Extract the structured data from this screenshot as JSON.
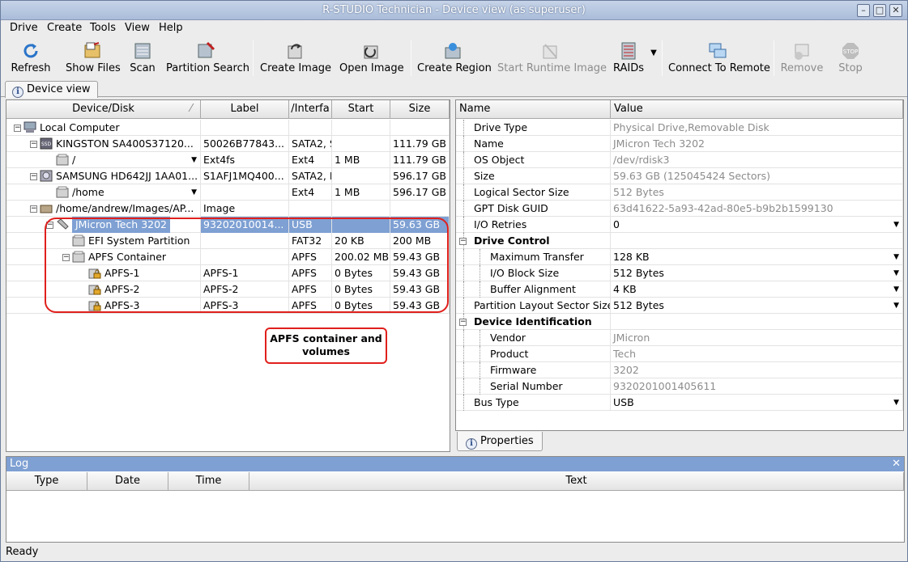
{
  "window": {
    "title": "R-STUDIO Technician - Device view (as superuser)"
  },
  "menu": [
    "Drive",
    "Create",
    "Tools",
    "View",
    "Help"
  ],
  "toolbar": {
    "refresh": "Refresh",
    "show_files": "Show Files",
    "scan": "Scan",
    "partition_search": "Partition Search",
    "create_image": "Create Image",
    "open_image": "Open Image",
    "create_region": "Create Region",
    "start_runtime_image": "Start Runtime Image",
    "raids": "RAIDs",
    "connect_to_remote": "Connect To Remote",
    "remove": "Remove",
    "stop": "Stop"
  },
  "tabs": {
    "device_view": "Device view",
    "properties": "Properties"
  },
  "device_table": {
    "columns": [
      "Device/Disk",
      "Label",
      "/Interfa",
      "Start",
      "Size"
    ],
    "rows": [
      [
        "Local Computer",
        "",
        "",
        "",
        ""
      ],
      [
        "KINGSTON SA400S37120...",
        "50026B77843...",
        "SATA2, SSD",
        "",
        "111.79 GB"
      ],
      [
        "/",
        "Ext4fs",
        "Ext4",
        "1 MB",
        "111.79 GB"
      ],
      [
        "SAMSUNG HD642JJ 1AA01...",
        "S1AFJ1MQ400...",
        "SATA2, HDD",
        "",
        "596.17 GB"
      ],
      [
        "/home",
        "",
        "Ext4",
        "1 MB",
        "596.17 GB"
      ],
      [
        "/home/andrew/Images/AP...",
        "Image",
        "",
        "",
        ""
      ],
      [
        "JMicron Tech 3202",
        "93202010014...",
        "USB",
        "",
        "59.63 GB"
      ],
      [
        "EFI System Partition",
        "",
        "FAT32",
        "20 KB",
        "200 MB"
      ],
      [
        "APFS Container",
        "",
        "APFS",
        "200.02 MB",
        "59.43 GB"
      ],
      [
        "APFS-1",
        "APFS-1",
        "APFS",
        "0 Bytes",
        "59.43 GB"
      ],
      [
        "APFS-2",
        "APFS-2",
        "APFS",
        "0 Bytes",
        "59.43 GB"
      ],
      [
        "APFS-3",
        "APFS-3",
        "APFS",
        "0 Bytes",
        "59.43 GB"
      ]
    ]
  },
  "annotation": {
    "callout": "APFS container and volumes"
  },
  "properties": {
    "columns": [
      "Name",
      "Value"
    ],
    "rows": [
      [
        "Drive Type",
        "Physical Drive,Removable Disk"
      ],
      [
        "Name",
        "JMicron Tech 3202"
      ],
      [
        "OS Object",
        "/dev/rdisk3"
      ],
      [
        "Size",
        "59.63 GB (125045424 Sectors)"
      ],
      [
        "Logical Sector Size",
        "512 Bytes"
      ],
      [
        "GPT Disk GUID",
        "63d41622-5a93-42ad-80e5-b9b2b1599130"
      ],
      [
        "I/O Retries",
        "0"
      ],
      [
        "Drive Control",
        ""
      ],
      [
        "Maximum Transfer",
        "128 KB"
      ],
      [
        "I/O Block Size",
        "512 Bytes"
      ],
      [
        "Buffer Alignment",
        "4 KB"
      ],
      [
        "Partition Layout Sector Size",
        "512 Bytes"
      ],
      [
        "Device Identification",
        ""
      ],
      [
        "Vendor",
        "JMicron"
      ],
      [
        "Product",
        "Tech"
      ],
      [
        "Firmware",
        "3202"
      ],
      [
        "Serial Number",
        "9320201001405611"
      ],
      [
        "Bus Type",
        "USB"
      ]
    ]
  },
  "log": {
    "title": "Log",
    "columns": [
      "Type",
      "Date",
      "Time",
      "Text"
    ]
  },
  "status": "Ready"
}
